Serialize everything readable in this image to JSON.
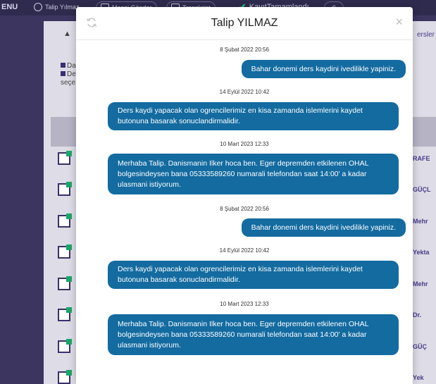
{
  "topbar": {
    "menu": "ENU",
    "user": "Talip Yılmaz",
    "message": "Mesaj Gönder",
    "transcript": "Transkript",
    "status": "KayıtTamamlandı"
  },
  "panel": {
    "tabs_label": "ersler",
    "legend_1": "Da",
    "legend_2": "De",
    "legend_3": "seçe",
    "side_names": [
      "RAFE",
      "GÜÇL",
      "Mehr",
      "Yekta",
      "Mehr",
      "Dr.",
      "GÜÇ",
      "Yek"
    ]
  },
  "modal": {
    "title": "Talip YILMAZ",
    "close": "×",
    "messages": [
      {
        "time": "8 Şubat 2022 20:56",
        "text": "Bahar donemi ders kaydini ivedilikle yapiniz.",
        "dir": "out"
      },
      {
        "time": "14 Eylül 2022 10:42",
        "text": "Ders kaydi yapacak olan ogrencilerimiz en kisa zamanda islemlerini kaydet butonuna basarak sonuclandirmalidir.",
        "dir": "in"
      },
      {
        "time": "10 Mart 2023 12:33",
        "text": "Merhaba Talip. Danismanin Ilker hoca ben. Eger depremden etkilenen OHAL bolgesindeysen bana 05333589260 numarali telefondan saat 14:00' a kadar ulasmani istiyorum.",
        "dir": "in"
      },
      {
        "time": "8 Şubat 2022 20:56",
        "text": "Bahar donemi ders kaydini ivedilikle yapiniz.",
        "dir": "out"
      },
      {
        "time": "14 Eylül 2022 10:42",
        "text": "Ders kaydi yapacak olan ogrencilerimiz en kisa zamanda islemlerini kaydet butonuna basarak sonuclandirmalidir.",
        "dir": "in"
      },
      {
        "time": "10 Mart 2023 12:33",
        "text": "Merhaba Talip. Danismanin Ilker hoca ben. Eger depremden etkilenen OHAL bolgesindeysen bana 05333589260 numarali telefondan saat 14:00' a kadar ulasmani istiyorum.",
        "dir": "in"
      }
    ]
  }
}
